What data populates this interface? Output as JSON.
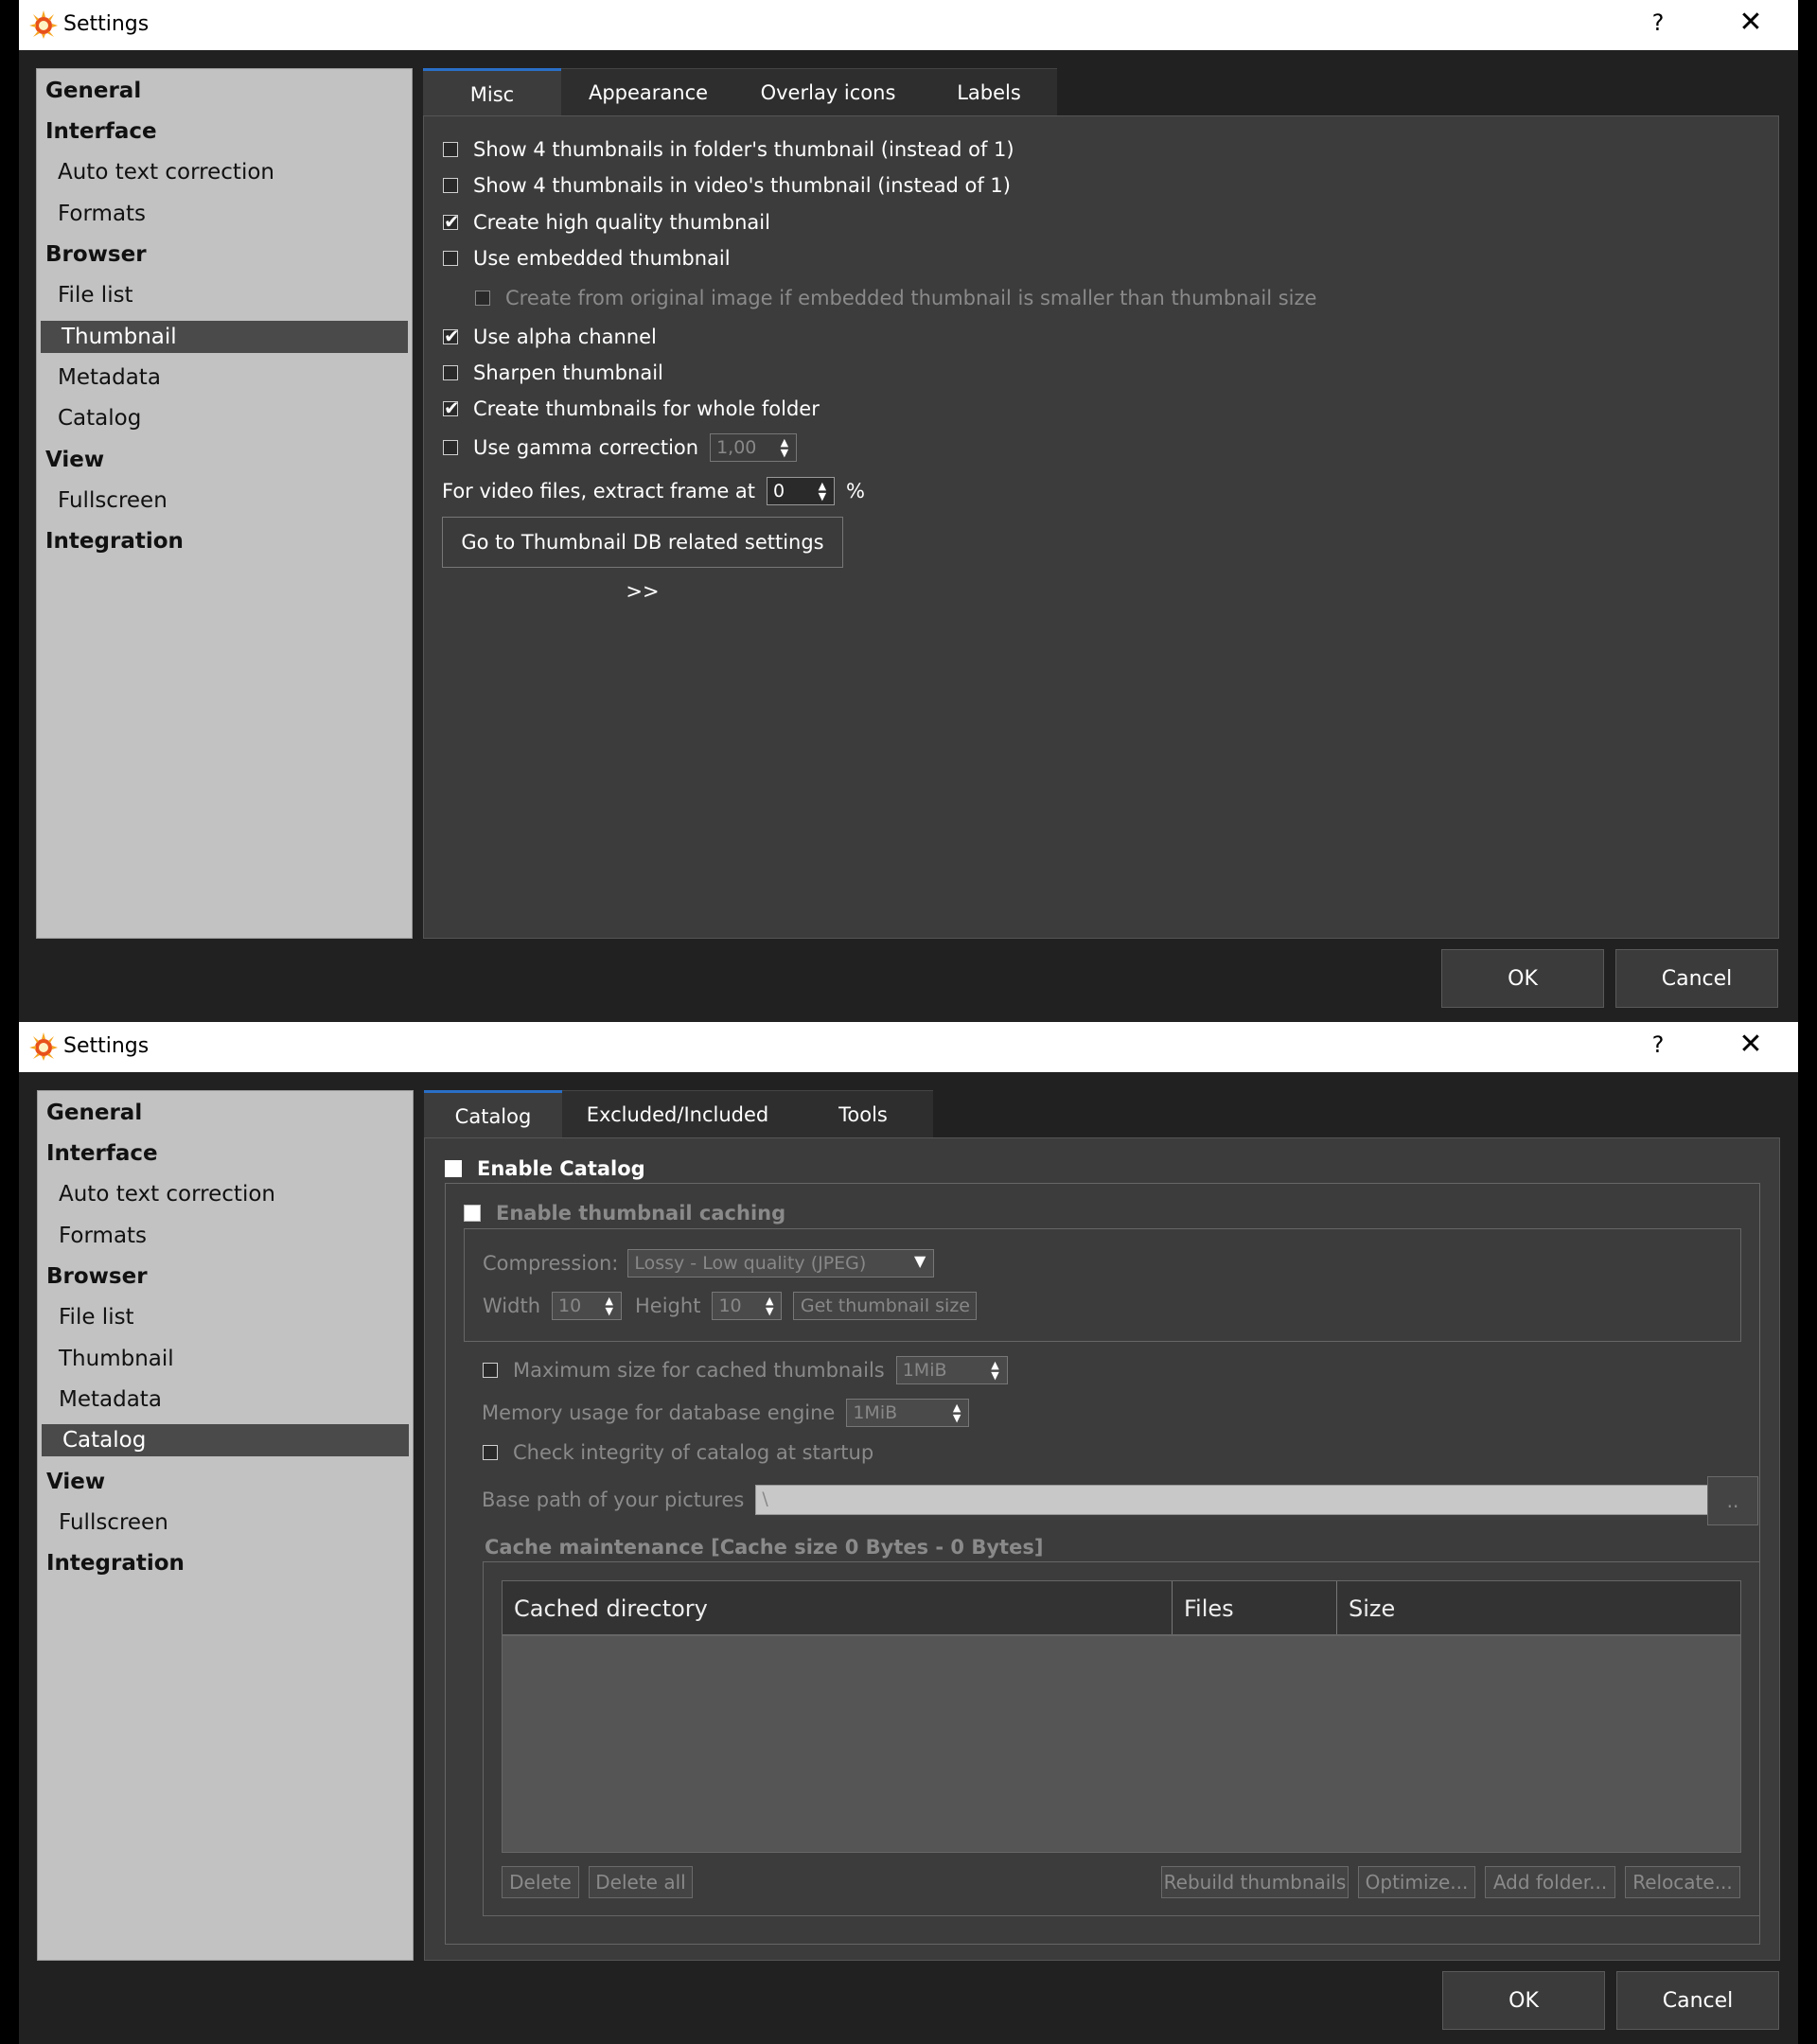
{
  "windows": [
    {
      "title": "Settings",
      "help": "?",
      "close": "✕",
      "nav": [
        {
          "label": "General",
          "type": "cat"
        },
        {
          "label": "Interface",
          "type": "cat"
        },
        {
          "label": "Auto text correction",
          "type": "sub"
        },
        {
          "label": "Formats",
          "type": "sub"
        },
        {
          "label": "Browser",
          "type": "cat"
        },
        {
          "label": "File list",
          "type": "sub"
        },
        {
          "label": "Thumbnail",
          "type": "sub",
          "selected": true
        },
        {
          "label": "Metadata",
          "type": "sub"
        },
        {
          "label": "Catalog",
          "type": "sub"
        },
        {
          "label": "View",
          "type": "cat"
        },
        {
          "label": "Fullscreen",
          "type": "sub"
        },
        {
          "label": "Integration",
          "type": "cat"
        }
      ],
      "tabs": [
        "Misc",
        "Appearance",
        "Overlay icons",
        "Labels"
      ],
      "active_tab": "Misc",
      "options": [
        {
          "label": "Show 4 thumbnails in folder's thumbnail (instead of 1)",
          "checked": false
        },
        {
          "label": "Show 4 thumbnails in video's thumbnail (instead of 1)",
          "checked": false
        },
        {
          "label": "Create high quality thumbnail",
          "checked": true
        },
        {
          "label": "Use embedded thumbnail",
          "checked": false
        },
        {
          "label": "Create from original image if embedded thumbnail is smaller than thumbnail size",
          "checked": false,
          "disabled": true
        },
        {
          "label": "Use alpha channel",
          "checked": true
        },
        {
          "label": "Sharpen thumbnail",
          "checked": false
        },
        {
          "label": "Create  thumbnails for whole folder",
          "checked": true
        },
        {
          "label": "Use gamma correction",
          "checked": false
        }
      ],
      "gamma_value": "1,00",
      "video_frame_label": "For video files, extract frame at",
      "video_frame_value": "0",
      "video_frame_unit": "%",
      "goto_button": "Go to Thumbnail DB related settings >>",
      "ok": "OK",
      "cancel": "Cancel"
    },
    {
      "title": "Settings",
      "help": "?",
      "close": "✕",
      "nav": [
        {
          "label": "General",
          "type": "cat"
        },
        {
          "label": "Interface",
          "type": "cat"
        },
        {
          "label": "Auto text correction",
          "type": "sub"
        },
        {
          "label": "Formats",
          "type": "sub"
        },
        {
          "label": "Browser",
          "type": "cat"
        },
        {
          "label": "File list",
          "type": "sub"
        },
        {
          "label": "Thumbnail",
          "type": "sub"
        },
        {
          "label": "Metadata",
          "type": "sub"
        },
        {
          "label": "Catalog",
          "type": "sub",
          "selected": true
        },
        {
          "label": "View",
          "type": "cat"
        },
        {
          "label": "Fullscreen",
          "type": "sub"
        },
        {
          "label": "Integration",
          "type": "cat"
        }
      ],
      "tabs": [
        "Catalog",
        "Excluded/Included",
        "Tools"
      ],
      "active_tab": "Catalog",
      "enable_catalog": "Enable Catalog",
      "enable_thumb_caching": "Enable thumbnail caching",
      "compression_label": "Compression:",
      "compression_value": "Lossy - Low quality (JPEG)",
      "width_label": "Width",
      "width_value": "10",
      "height_label": "Height",
      "height_value": "10",
      "get_thumb_size": "Get thumbnail size",
      "max_size_label": "Maximum size for cached thumbnails",
      "max_size_value": "1MiB",
      "memory_label": "Memory usage for database engine",
      "memory_value": "1MiB",
      "check_integrity": "Check integrity of catalog at startup",
      "base_path_label": "Base path of your pictures",
      "base_path_value": "\\",
      "browse_button": "..",
      "cache_title": "Cache maintenance [Cache size 0 Bytes - 0 Bytes]",
      "columns": [
        "Cached directory",
        "Files",
        "Size"
      ],
      "buttons": {
        "delete": "Delete",
        "delete_all": "Delete all",
        "rebuild": "Rebuild thumbnails",
        "optimize": "Optimize...",
        "add_folder": "Add folder...",
        "relocate": "Relocate..."
      },
      "ok": "OK",
      "cancel": "Cancel"
    }
  ]
}
